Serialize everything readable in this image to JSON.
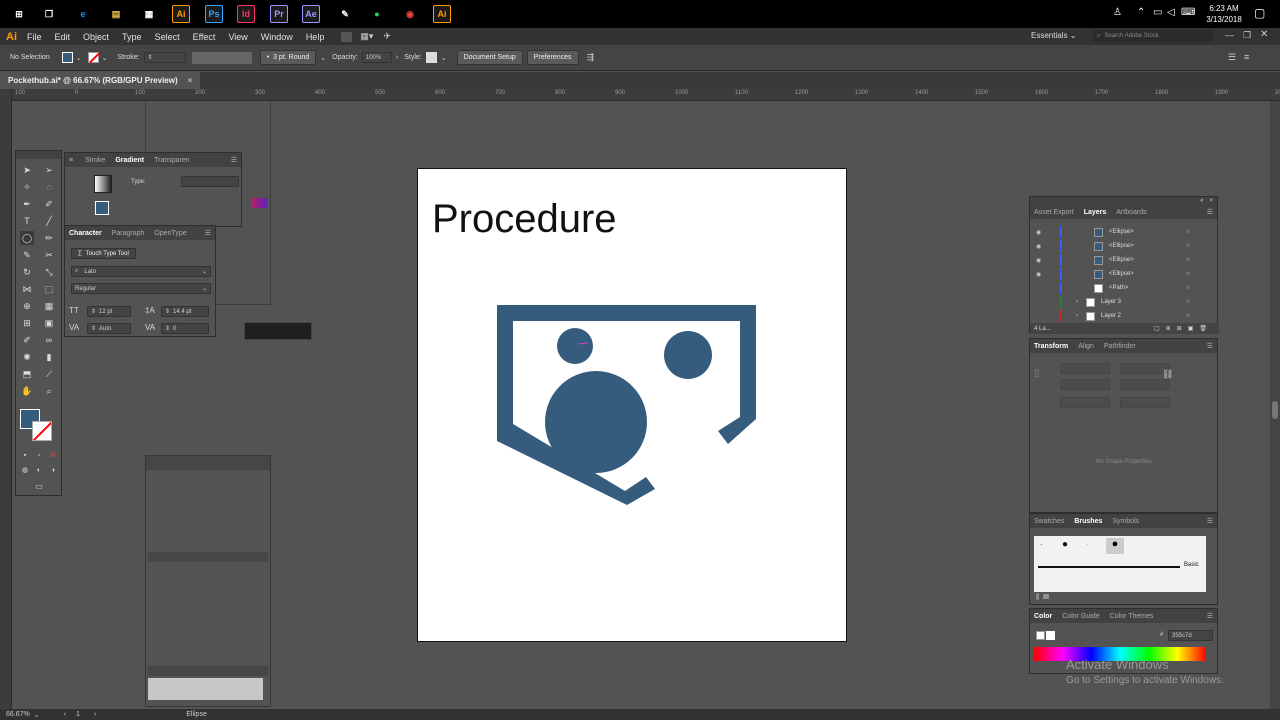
{
  "taskbar": {
    "clock_time": "6:23 AM",
    "clock_date": "3/13/2018",
    "apps": [
      {
        "name": "windows-start-icon",
        "glyph": "⊞",
        "color": "#ffffff"
      },
      {
        "name": "task-view-icon",
        "glyph": "❐",
        "color": "#ffffff"
      },
      {
        "name": "edge-icon",
        "glyph": "e",
        "color": "#1f8fe6"
      },
      {
        "name": "file-explorer-icon",
        "glyph": "▤",
        "color": "#f0c24b"
      },
      {
        "name": "store-icon",
        "glyph": "▦",
        "color": "#ffffff"
      },
      {
        "name": "illustrator-icon-1",
        "glyph": "Ai",
        "color": "#ff9a00"
      },
      {
        "name": "photoshop-icon",
        "glyph": "Ps",
        "color": "#31a8ff"
      },
      {
        "name": "indesign-icon",
        "glyph": "Id",
        "color": "#ff3366"
      },
      {
        "name": "premiere-icon",
        "glyph": "Pr",
        "color": "#9999ff"
      },
      {
        "name": "after-effects-icon",
        "glyph": "Ae",
        "color": "#9999ff"
      },
      {
        "name": "notepad-icon",
        "glyph": "✎",
        "color": "#ffffff"
      },
      {
        "name": "spotify-icon",
        "glyph": "●",
        "color": "#1ed760"
      },
      {
        "name": "chrome-icon",
        "glyph": "◉",
        "color": "#e8453c"
      },
      {
        "name": "illustrator-icon-2",
        "glyph": "Ai",
        "color": "#ff9a00"
      }
    ]
  },
  "menubar": {
    "logo": "Ai",
    "items": [
      "File",
      "Edit",
      "Object",
      "Type",
      "Select",
      "Effect",
      "View",
      "Window",
      "Help"
    ],
    "workspace": "Essentials",
    "search_placeholder": "Search Adobe Stock"
  },
  "control_bar": {
    "selection": "No Selection",
    "stroke_label": "Stroke:",
    "brush": "3 pt. Round",
    "opacity_label": "Opacity:",
    "opacity_value": "100%",
    "style_label": "Style:",
    "document_setup": "Document Setup",
    "preferences": "Preferences"
  },
  "document_tab": {
    "title": "Pockethub.ai* @ 66.67% (RGB/GPU Preview)",
    "close": "×"
  },
  "ruler": {
    "marks": [
      "100",
      "0",
      "100",
      "200",
      "300",
      "400",
      "500",
      "600",
      "700",
      "800",
      "900",
      "1000",
      "1100",
      "1200",
      "1300",
      "1400",
      "1500",
      "1600",
      "1700",
      "1800",
      "1900",
      "2000"
    ]
  },
  "status_bar": {
    "zoom": "66.67%",
    "artboard": "1",
    "tool": "Ellipse"
  },
  "artboard": {
    "title": "Procedure",
    "logo_color": "#355c7d"
  },
  "gradient_panel": {
    "tabs": [
      "Stroke",
      "Gradient",
      "Transparen"
    ],
    "type_label": "Type:"
  },
  "character_panel": {
    "tabs": [
      "Character",
      "Paragraph",
      "OpenType"
    ],
    "touch_tool": "Touch Type Tool",
    "font": "Lato",
    "style": "Regular",
    "size": "12 pt",
    "leading": "14.4 pt",
    "kerning": "Auto",
    "tracking": "0"
  },
  "layers_panel": {
    "tabs": [
      "Asset Export",
      "Layers",
      "Artboards"
    ],
    "rows": [
      "<Ellipse>",
      "<Ellipse>",
      "<Ellipse>",
      "<Ellipse>",
      "<Path>",
      "Layer 3",
      "Layer 2"
    ],
    "footer": "4 La..."
  },
  "transform_panel": {
    "tabs": [
      "Transform",
      "Align",
      "Pathfinder"
    ],
    "empty_text": "No Shape Properties"
  },
  "brushes_panel": {
    "tabs": [
      "Swatches",
      "Brushes",
      "Symbols"
    ],
    "basic_label": "Basic"
  },
  "color_panel": {
    "tabs": [
      "Color",
      "Color Guide",
      "Color Themes"
    ],
    "hex": "355c7d"
  },
  "watermark": {
    "line1": "Activate Windows",
    "line2": "Go to Settings to activate Windows."
  }
}
